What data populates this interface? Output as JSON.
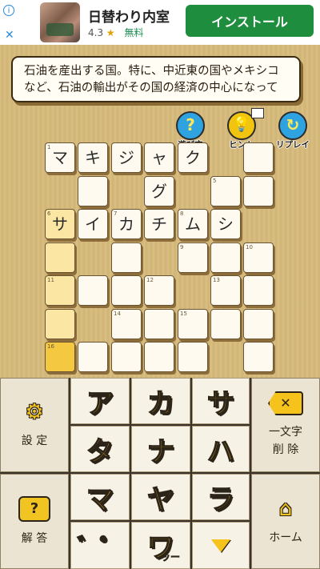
{
  "ad": {
    "info_icon": "i",
    "close_icon": "✕",
    "title": "日替わり内室",
    "rating": "4.3",
    "star": "★",
    "price": "無料",
    "install_label": "インストール"
  },
  "clue": {
    "text": "石油を産出する国。特に、中近東の国やメキシコなど、石油の輸出がその国の経済の中心になって"
  },
  "tools": {
    "help_label": "遊び方",
    "hint_label": "ヒント",
    "replay_label": "リプレイ",
    "help_glyph": "?",
    "hint_glyph": "💡",
    "replay_glyph": "↻"
  },
  "grid": {
    "cells": [
      {
        "r": 0,
        "c": 0,
        "num": "1",
        "ch": "マ",
        "state": "normal"
      },
      {
        "r": 0,
        "c": 1,
        "num": "",
        "ch": "キ",
        "state": "normal"
      },
      {
        "r": 0,
        "c": 2,
        "num": "",
        "ch": "ジ",
        "state": "normal"
      },
      {
        "r": 0,
        "c": 3,
        "num": "",
        "ch": "ャ",
        "state": "normal"
      },
      {
        "r": 0,
        "c": 4,
        "num": "",
        "ch": "ク",
        "state": "normal"
      },
      {
        "r": 0,
        "c": 6,
        "num": "",
        "ch": "",
        "state": "normal"
      },
      {
        "r": 1,
        "c": 1,
        "num": "",
        "ch": "",
        "state": "normal"
      },
      {
        "r": 1,
        "c": 3,
        "num": "",
        "ch": "グ",
        "state": "normal"
      },
      {
        "r": 1,
        "c": 5,
        "num": "5",
        "ch": "",
        "state": "normal"
      },
      {
        "r": 1,
        "c": 6,
        "num": "",
        "ch": "",
        "state": "normal"
      },
      {
        "r": 2,
        "c": 0,
        "num": "6",
        "ch": "サ",
        "state": "hl"
      },
      {
        "r": 2,
        "c": 1,
        "num": "",
        "ch": "イ",
        "state": "normal"
      },
      {
        "r": 2,
        "c": 2,
        "num": "7",
        "ch": "カ",
        "state": "normal"
      },
      {
        "r": 2,
        "c": 3,
        "num": "",
        "ch": "チ",
        "state": "normal"
      },
      {
        "r": 2,
        "c": 4,
        "num": "8",
        "ch": "ム",
        "state": "normal"
      },
      {
        "r": 2,
        "c": 5,
        "num": "",
        "ch": "シ",
        "state": "normal"
      },
      {
        "r": 3,
        "c": 0,
        "num": "",
        "ch": "",
        "state": "hl"
      },
      {
        "r": 3,
        "c": 2,
        "num": "",
        "ch": "",
        "state": "normal"
      },
      {
        "r": 3,
        "c": 4,
        "num": "9",
        "ch": "",
        "state": "normal"
      },
      {
        "r": 3,
        "c": 5,
        "num": "",
        "ch": "",
        "state": "normal"
      },
      {
        "r": 3,
        "c": 6,
        "num": "10",
        "ch": "",
        "state": "normal"
      },
      {
        "r": 4,
        "c": 0,
        "num": "11",
        "ch": "",
        "state": "hl"
      },
      {
        "r": 4,
        "c": 1,
        "num": "",
        "ch": "",
        "state": "normal"
      },
      {
        "r": 4,
        "c": 2,
        "num": "",
        "ch": "",
        "state": "normal"
      },
      {
        "r": 4,
        "c": 3,
        "num": "12",
        "ch": "",
        "state": "normal"
      },
      {
        "r": 4,
        "c": 5,
        "num": "13",
        "ch": "",
        "state": "normal"
      },
      {
        "r": 4,
        "c": 6,
        "num": "",
        "ch": "",
        "state": "normal"
      },
      {
        "r": 5,
        "c": 0,
        "num": "",
        "ch": "",
        "state": "hl"
      },
      {
        "r": 5,
        "c": 2,
        "num": "14",
        "ch": "",
        "state": "normal"
      },
      {
        "r": 5,
        "c": 3,
        "num": "",
        "ch": "",
        "state": "normal"
      },
      {
        "r": 5,
        "c": 4,
        "num": "15",
        "ch": "",
        "state": "normal"
      },
      {
        "r": 5,
        "c": 5,
        "num": "",
        "ch": "",
        "state": "normal"
      },
      {
        "r": 5,
        "c": 6,
        "num": "",
        "ch": "",
        "state": "normal"
      },
      {
        "r": 6,
        "c": 0,
        "num": "16",
        "ch": "",
        "state": "sel"
      },
      {
        "r": 6,
        "c": 1,
        "num": "",
        "ch": "",
        "state": "normal"
      },
      {
        "r": 6,
        "c": 2,
        "num": "",
        "ch": "",
        "state": "normal"
      },
      {
        "r": 6,
        "c": 3,
        "num": "",
        "ch": "",
        "state": "normal"
      },
      {
        "r": 6,
        "c": 4,
        "num": "",
        "ch": "",
        "state": "normal"
      },
      {
        "r": 6,
        "c": 6,
        "num": "",
        "ch": "",
        "state": "normal"
      }
    ]
  },
  "keyboard": {
    "settings_label": "設 定",
    "delete_label_1": "一文字",
    "delete_label_2": "削 除",
    "answer_label": "解 答",
    "home_label": "ホーム",
    "keys": [
      "ア",
      "カ",
      "サ",
      "タ",
      "ナ",
      "ハ",
      "マ",
      "ヤ",
      "ラ",
      "゛゜",
      "ワ"
    ],
    "wa_sub": "ッー",
    "delete_glyph": "✕",
    "answer_glyph": "?"
  }
}
